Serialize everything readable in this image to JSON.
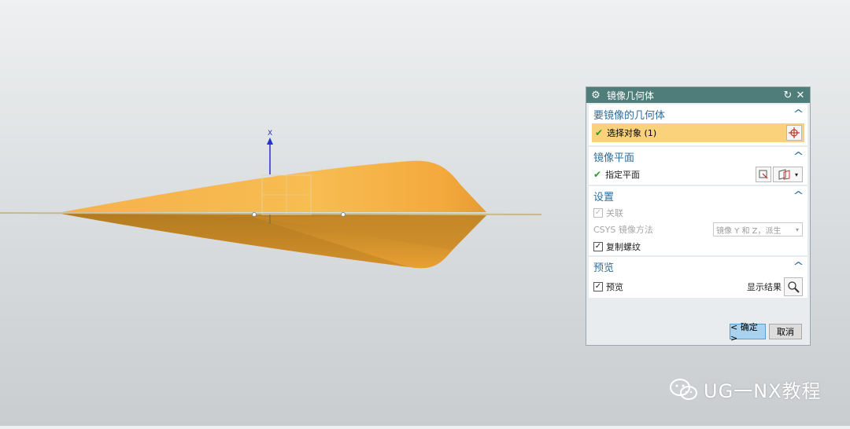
{
  "viewport": {
    "axis_label": "X"
  },
  "dialog": {
    "title": "镜像几何体",
    "title_icon": "gear-icon",
    "reset_icon": "reset-icon",
    "close_icon": "close-icon",
    "sections": {
      "geometry": {
        "header": "要镜像的几何体",
        "select_label": "选择对象 (1)"
      },
      "plane": {
        "header": "镜像平面",
        "specify_label": "指定平面"
      },
      "settings": {
        "header": "设置",
        "associative_label": "关联",
        "csys_label": "CSYS 镜像方法",
        "csys_value": "镜像 Y 和 Z，派生",
        "copy_threads_label": "复制螺纹"
      },
      "preview": {
        "header": "预览",
        "preview_label": "预览",
        "show_result_label": "显示结果"
      }
    },
    "ok_label": "< 确定 >",
    "cancel_label": "取消"
  },
  "watermark": {
    "text": "UG一NX教程"
  },
  "colors": {
    "titlebar": "#4f7d7a",
    "section_header": "#2d6d9b",
    "selection_highlight": "#f9d27b",
    "model_orange": "#f2a335"
  }
}
